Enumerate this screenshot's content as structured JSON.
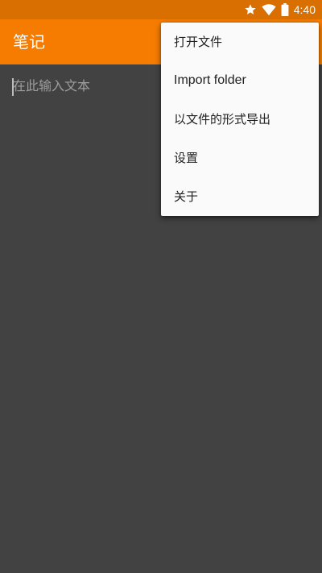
{
  "status_bar": {
    "time": "4:40",
    "icons": [
      "star-icon",
      "wifi-icon",
      "battery-icon"
    ],
    "background": "#d86f00"
  },
  "app_bar": {
    "title": "笔记",
    "background": "#f57c00"
  },
  "editor": {
    "placeholder": "在此输入文本",
    "value": ""
  },
  "overflow_menu": {
    "items": [
      {
        "label": "打开文件"
      },
      {
        "label": "Import folder"
      },
      {
        "label": "以文件的形式导出"
      },
      {
        "label": "设置"
      },
      {
        "label": "关于"
      }
    ]
  },
  "colors": {
    "accent": "#f57c00",
    "canvas": "#424242",
    "menu_background": "#fafafa",
    "menu_text": "#212121"
  }
}
